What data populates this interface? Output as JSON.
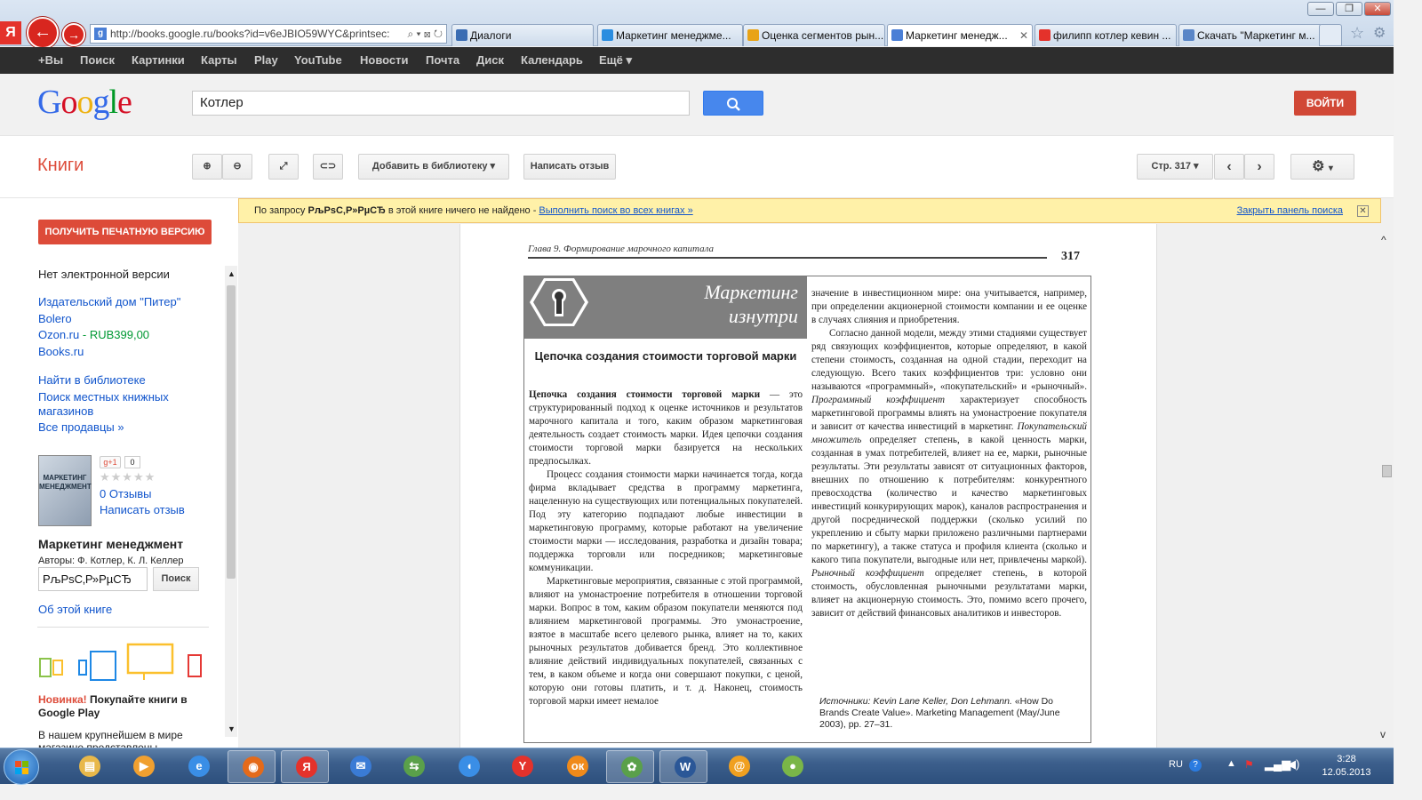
{
  "browser": {
    "yandex_letter": "Я",
    "url": "http://books.google.ru/books?id=v6eJBIO59WYC&printsec:",
    "tabs": [
      {
        "label": "Диалоги",
        "color": "#3b6db3"
      },
      {
        "label": "Маркетинг менеджме...",
        "color": "#2a8de0"
      },
      {
        "label": "Оценка сегментов рын...",
        "color": "#e8a317"
      },
      {
        "label": "Маркетинг менедж...",
        "color": "#4a7fd6",
        "active": true
      },
      {
        "label": "филипп котлер кевин ...",
        "color": "#e4322b"
      },
      {
        "label": "Скачать \"Маркетинг м...",
        "color": "#5a86c7"
      }
    ]
  },
  "gbar": [
    "+Вы",
    "Поиск",
    "Картинки",
    "Карты",
    "Play",
    "YouTube",
    "Новости",
    "Почта",
    "Диск",
    "Календарь",
    "Ещё ▾"
  ],
  "header": {
    "search_value": "Котлер",
    "login_label": "ВОЙТИ"
  },
  "books_bar": {
    "title": "Книги",
    "add_library": "Добавить в библиотеку",
    "write_review": "Написать отзыв",
    "page_select": "Стр. 317"
  },
  "notice": {
    "prefix": "По запросу",
    "query": "РљРѕС‚Р»РµСЂ",
    "suffix": "в этой книге ничего не найдено",
    "search_all": "Выполнить поиск во всех книгах »",
    "close_panel": "Закрыть панель поиска"
  },
  "sidebar": {
    "print_button": "ПОЛУЧИТЬ ПЕЧАТНУЮ ВЕРСИЮ",
    "no_ebook": "Нет электронной версии",
    "sellers": [
      "Издательский дом \"Питер\"",
      "Bolero"
    ],
    "ozon_name": "Ozon.ru",
    "ozon_price": "- RUB399,00",
    "books_ru": "Books.ru",
    "find_library": "Найти в библиотеке",
    "local_stores": "Поиск местных книжных магазинов",
    "all_sellers": "Все продавцы »",
    "cover_text": "МАРКЕТИНГ МЕНЕДЖМЕНТ",
    "gplus": "g+1",
    "gplus_count": "0",
    "stars": "★★★★★",
    "reviews": "0 Отзывы",
    "write_review": "Написать отзыв",
    "book_title": "Маркетинг менеджмент",
    "authors": "Авторы: Ф. Котлер, К. Л. Келлер",
    "in_book_search_value": "РљРѕС‚Р»РµСЂ",
    "in_book_search_button": "Поиск",
    "about": "Об этой книге",
    "promo_new": "Новинка!",
    "promo_text": "Покупайте книги в Google Play",
    "store_text": "В нашем крупнейшем в мире магазине представлены"
  },
  "book_page": {
    "running_head": "Глава 9. Формирование марочного капитала",
    "page_number": "317",
    "box_label": "Маркетинг\nизнутри",
    "box_title": "Цепочка создания стоимости торговой марки",
    "col1": [
      {
        "lead": "Цепочка создания стоимости торговой марки",
        "text": " — это структурированный подход к оценке источников и результатов марочного капитала и того, каким образом маркетинговая деятельность создает стоимость марки. Идея цепочки создания стоимости торговой марки базируется на нескольких предпосылках."
      },
      {
        "text": "Процесс создания стоимости марки начинается тогда, когда фирма вкладывает средства в программу маркетинга, нацеленную на существующих или потенциальных покупателей. Под эту категорию подпадают любые инвестиции в маркетинговую программу, которые работают на увеличение стоимости марки — исследования, разработка и дизайн товара; поддержка торговли или посредников; маркетинговые коммуникации."
      },
      {
        "text": "Маркетинговые мероприятия, связанные с этой программой, влияют на умонастроение потребителя в отношении торговой марки. Вопрос в том, каким образом покупатели меняются под влиянием маркетинговой программы. Это умонастроение, взятое в масштабе всего целевого рынка, влияет на то, каких рыночных результатов добивается бренд. Это коллективное влияние действий индивидуальных покупателей, связанных с тем, в каком объеме и когда они совершают покупки, с ценой, которую они готовы платить, и т. д. Наконец, стоимость торговой марки имеет немалое"
      }
    ],
    "col2": [
      {
        "text": "значение в инвестиционном мире: она учитывается, например, при определении акционерной стоимости компании и ее оценке в случаях слияния и приобретения.",
        "noindent": true
      },
      {
        "text": "Согласно данной модели, между этими стадиями существует ряд связующих коэффициентов, которые определяют, в какой степени стоимость, созданная на одной стадии, переходит на следующую. Всего таких коэффициентов три: условно они называются «программный», «покупательский» и «рыночный».",
        "i1": "Программный коэффициент",
        "t1": " характеризует способность маркетинговой программы влиять на умонастроение покупателя и зависит от качества инвестиций в маркетинг.",
        "i2": "Покупательский множитель",
        "t2": " определяет степень, в какой ценность марки, созданная в умах потребителей, влияет на ее, марки, рыночные результаты. Эти результаты зависят от ситуационных факторов, внешних по отношению к потребителям: конкурентного превосходства (количество и качество маркетинговых инвестиций конкурирующих марок), каналов распространения и другой посреднической поддержки (сколько усилий по укреплению и сбыту марки приложено различными партнерами по маркетингу), а также статуса и профиля клиента (сколько и какого типа покупатели, выгодные или нет, привлечены маркой).",
        "i3": "Рыночный коэффициент",
        "t3": " определяет степень, в которой стоимость, обусловленная рыночными результатами марки, влияет на акционерную стоимость. Это, помимо всего прочего, зависит от действий финансовых аналитиков и инвесторов."
      }
    ],
    "sources_label": "Источники:",
    "sources_authors": "Kevin Lane Keller, Don Lehmann.",
    "sources_text": "«How Do Brands Create Value». Marketing Management (May/June 2003), pp. 27–31."
  },
  "taskbar": {
    "lang": "RU",
    "time": "3:28",
    "date": "12.05.2013",
    "apps": [
      {
        "name": "explorer",
        "glyph": "▤",
        "color": "#e8b84a"
      },
      {
        "name": "media-player",
        "glyph": "▶",
        "color": "#f0a030"
      },
      {
        "name": "internet-explorer",
        "glyph": "e",
        "color": "#3a8ee6"
      },
      {
        "name": "firefox",
        "glyph": "◉",
        "color": "#e46a1a"
      },
      {
        "name": "yandex",
        "glyph": "Я",
        "color": "#e4322b"
      },
      {
        "name": "mail",
        "glyph": "✉",
        "color": "#3a7bd5"
      },
      {
        "name": "app-green",
        "glyph": "⇆",
        "color": "#5aa04a"
      },
      {
        "name": "volume-app",
        "glyph": "◖",
        "color": "#3a8ee6"
      },
      {
        "name": "yandex-browser",
        "glyph": "Y",
        "color": "#e4322b"
      },
      {
        "name": "odnoklassniki",
        "glyph": "ок",
        "color": "#f08a1a"
      },
      {
        "name": "agent",
        "glyph": "✿",
        "color": "#5aa04a"
      },
      {
        "name": "word",
        "glyph": "W",
        "color": "#2b5797"
      },
      {
        "name": "mail-agent",
        "glyph": "@",
        "color": "#f0a020"
      },
      {
        "name": "app-ball",
        "glyph": "●",
        "color": "#7ab648"
      }
    ]
  }
}
